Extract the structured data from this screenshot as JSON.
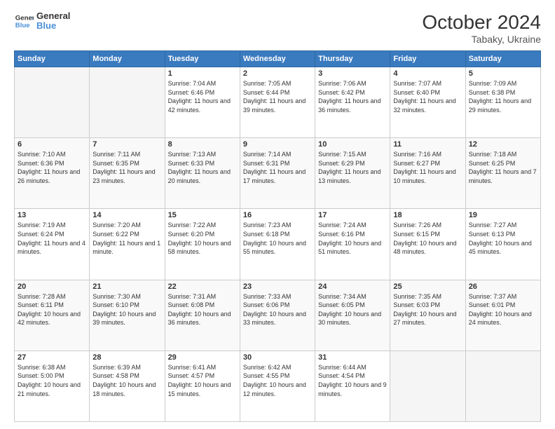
{
  "header": {
    "logo_line1": "General",
    "logo_line2": "Blue",
    "title": "October 2024",
    "subtitle": "Tabaky, Ukraine"
  },
  "weekdays": [
    "Sunday",
    "Monday",
    "Tuesday",
    "Wednesday",
    "Thursday",
    "Friday",
    "Saturday"
  ],
  "weeks": [
    [
      {
        "day": "",
        "info": ""
      },
      {
        "day": "",
        "info": ""
      },
      {
        "day": "1",
        "info": "Sunrise: 7:04 AM\nSunset: 6:46 PM\nDaylight: 11 hours and 42 minutes."
      },
      {
        "day": "2",
        "info": "Sunrise: 7:05 AM\nSunset: 6:44 PM\nDaylight: 11 hours and 39 minutes."
      },
      {
        "day": "3",
        "info": "Sunrise: 7:06 AM\nSunset: 6:42 PM\nDaylight: 11 hours and 36 minutes."
      },
      {
        "day": "4",
        "info": "Sunrise: 7:07 AM\nSunset: 6:40 PM\nDaylight: 11 hours and 32 minutes."
      },
      {
        "day": "5",
        "info": "Sunrise: 7:09 AM\nSunset: 6:38 PM\nDaylight: 11 hours and 29 minutes."
      }
    ],
    [
      {
        "day": "6",
        "info": "Sunrise: 7:10 AM\nSunset: 6:36 PM\nDaylight: 11 hours and 26 minutes."
      },
      {
        "day": "7",
        "info": "Sunrise: 7:11 AM\nSunset: 6:35 PM\nDaylight: 11 hours and 23 minutes."
      },
      {
        "day": "8",
        "info": "Sunrise: 7:13 AM\nSunset: 6:33 PM\nDaylight: 11 hours and 20 minutes."
      },
      {
        "day": "9",
        "info": "Sunrise: 7:14 AM\nSunset: 6:31 PM\nDaylight: 11 hours and 17 minutes."
      },
      {
        "day": "10",
        "info": "Sunrise: 7:15 AM\nSunset: 6:29 PM\nDaylight: 11 hours and 13 minutes."
      },
      {
        "day": "11",
        "info": "Sunrise: 7:16 AM\nSunset: 6:27 PM\nDaylight: 11 hours and 10 minutes."
      },
      {
        "day": "12",
        "info": "Sunrise: 7:18 AM\nSunset: 6:25 PM\nDaylight: 11 hours and 7 minutes."
      }
    ],
    [
      {
        "day": "13",
        "info": "Sunrise: 7:19 AM\nSunset: 6:24 PM\nDaylight: 11 hours and 4 minutes."
      },
      {
        "day": "14",
        "info": "Sunrise: 7:20 AM\nSunset: 6:22 PM\nDaylight: 11 hours and 1 minute."
      },
      {
        "day": "15",
        "info": "Sunrise: 7:22 AM\nSunset: 6:20 PM\nDaylight: 10 hours and 58 minutes."
      },
      {
        "day": "16",
        "info": "Sunrise: 7:23 AM\nSunset: 6:18 PM\nDaylight: 10 hours and 55 minutes."
      },
      {
        "day": "17",
        "info": "Sunrise: 7:24 AM\nSunset: 6:16 PM\nDaylight: 10 hours and 51 minutes."
      },
      {
        "day": "18",
        "info": "Sunrise: 7:26 AM\nSunset: 6:15 PM\nDaylight: 10 hours and 48 minutes."
      },
      {
        "day": "19",
        "info": "Sunrise: 7:27 AM\nSunset: 6:13 PM\nDaylight: 10 hours and 45 minutes."
      }
    ],
    [
      {
        "day": "20",
        "info": "Sunrise: 7:28 AM\nSunset: 6:11 PM\nDaylight: 10 hours and 42 minutes."
      },
      {
        "day": "21",
        "info": "Sunrise: 7:30 AM\nSunset: 6:10 PM\nDaylight: 10 hours and 39 minutes."
      },
      {
        "day": "22",
        "info": "Sunrise: 7:31 AM\nSunset: 6:08 PM\nDaylight: 10 hours and 36 minutes."
      },
      {
        "day": "23",
        "info": "Sunrise: 7:33 AM\nSunset: 6:06 PM\nDaylight: 10 hours and 33 minutes."
      },
      {
        "day": "24",
        "info": "Sunrise: 7:34 AM\nSunset: 6:05 PM\nDaylight: 10 hours and 30 minutes."
      },
      {
        "day": "25",
        "info": "Sunrise: 7:35 AM\nSunset: 6:03 PM\nDaylight: 10 hours and 27 minutes."
      },
      {
        "day": "26",
        "info": "Sunrise: 7:37 AM\nSunset: 6:01 PM\nDaylight: 10 hours and 24 minutes."
      }
    ],
    [
      {
        "day": "27",
        "info": "Sunrise: 6:38 AM\nSunset: 5:00 PM\nDaylight: 10 hours and 21 minutes."
      },
      {
        "day": "28",
        "info": "Sunrise: 6:39 AM\nSunset: 4:58 PM\nDaylight: 10 hours and 18 minutes."
      },
      {
        "day": "29",
        "info": "Sunrise: 6:41 AM\nSunset: 4:57 PM\nDaylight: 10 hours and 15 minutes."
      },
      {
        "day": "30",
        "info": "Sunrise: 6:42 AM\nSunset: 4:55 PM\nDaylight: 10 hours and 12 minutes."
      },
      {
        "day": "31",
        "info": "Sunrise: 6:44 AM\nSunset: 4:54 PM\nDaylight: 10 hours and 9 minutes."
      },
      {
        "day": "",
        "info": ""
      },
      {
        "day": "",
        "info": ""
      }
    ]
  ]
}
